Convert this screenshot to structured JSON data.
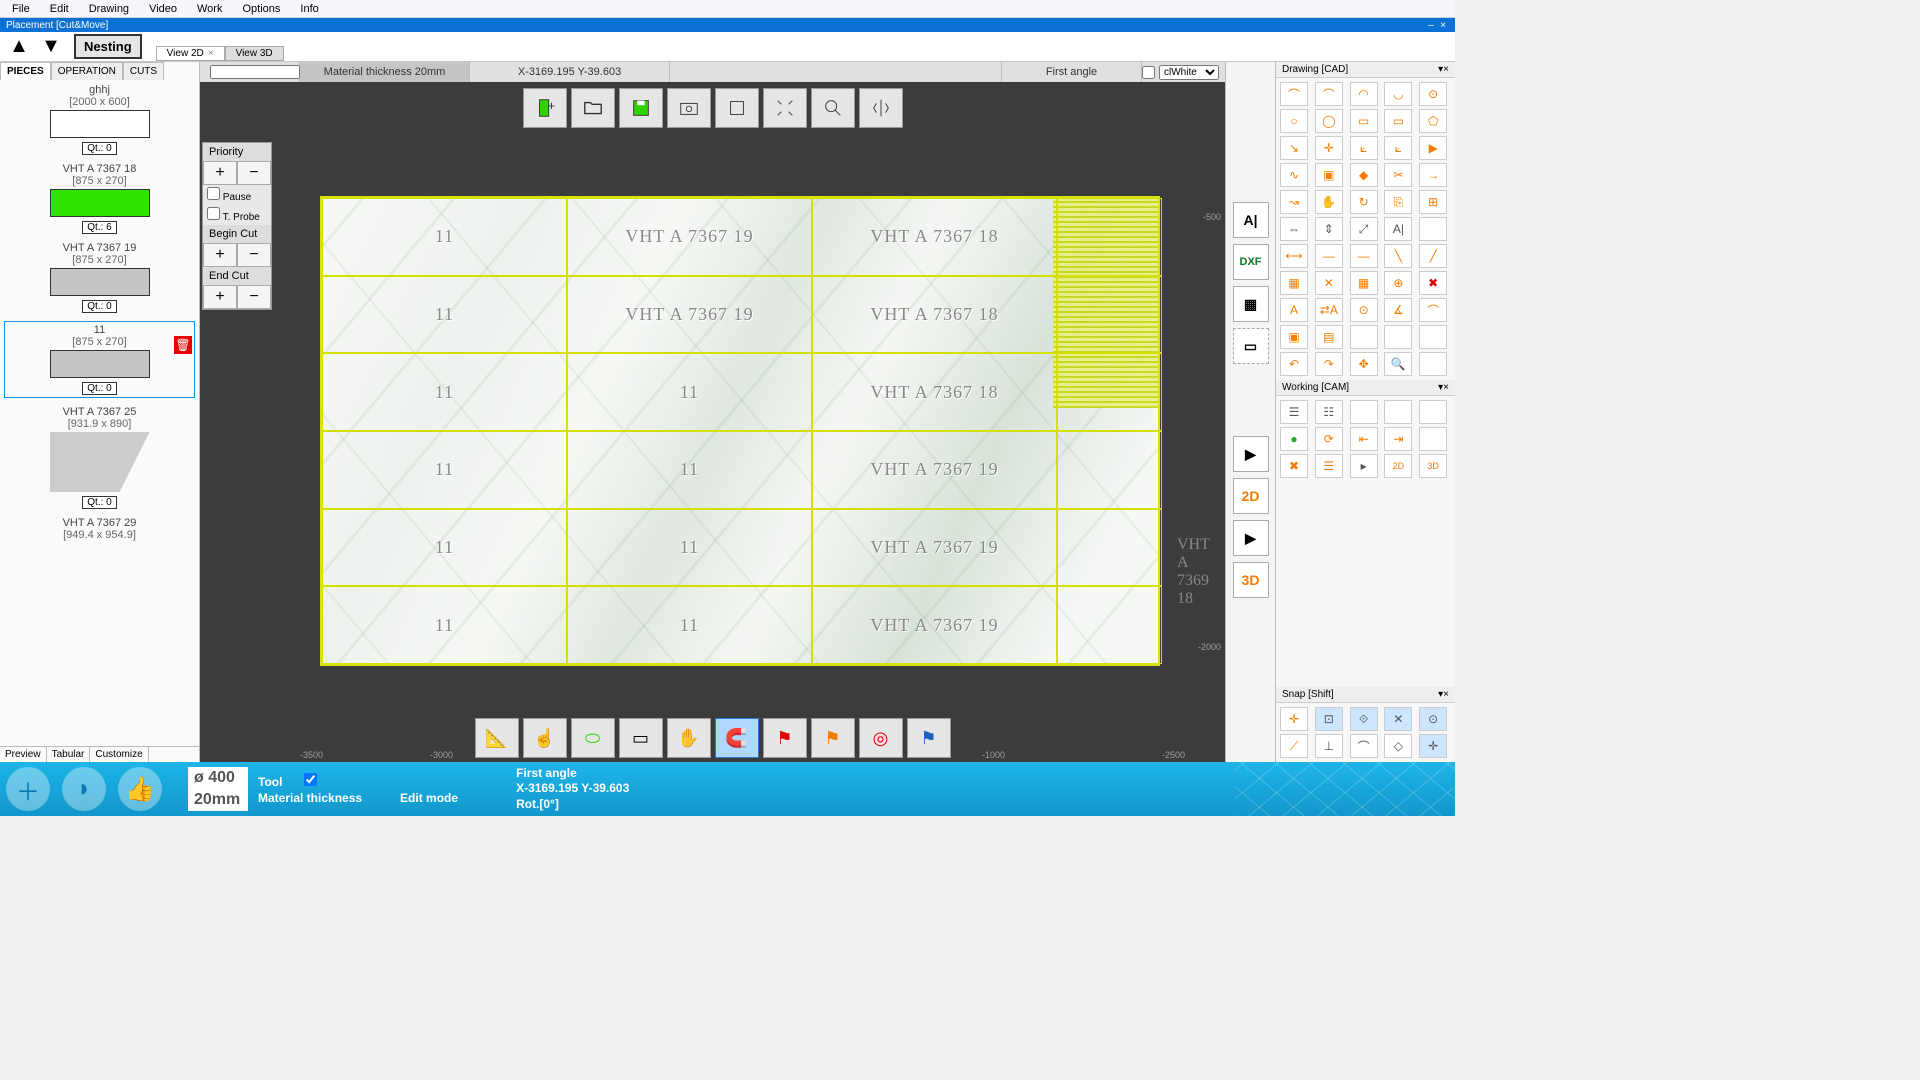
{
  "menu": [
    "File",
    "Edit",
    "Drawing",
    "Video",
    "Work",
    "Options",
    "Info"
  ],
  "title2": "Placement [Cut&Move]",
  "nesting": "Nesting",
  "view_tabs": [
    {
      "label": "View 2D",
      "active": true,
      "closable": true
    },
    {
      "label": "View 3D",
      "active": false,
      "closable": false
    }
  ],
  "left_tabs": [
    "PIECES",
    "OPERATION",
    "CUTS"
  ],
  "pieces": [
    {
      "name": "ghhj",
      "dims": "[2000 x 600]",
      "swatch": "white",
      "qt": "Qt.: 0"
    },
    {
      "name": "VHT A 7367  18",
      "dims": "[875 x 270]",
      "swatch": "green",
      "qt": "Qt.: 6"
    },
    {
      "name": "VHT A 7367  19",
      "dims": "[875 x 270]",
      "swatch": "grey",
      "qt": "Qt.: 0"
    },
    {
      "name": "11",
      "dims": "[875 x 270]",
      "swatch": "grey",
      "qt": "Qt.: 0",
      "selected": true,
      "trash": true
    },
    {
      "name": "VHT A 7367  25",
      "dims": "[931.9 x 890]",
      "swatch": "poly",
      "qt": "Qt.: 0"
    },
    {
      "name": "VHT A 7367  29",
      "dims": "[949.4 x 954.9]",
      "swatch": "poly",
      "qt": ""
    }
  ],
  "bottom_tabs": [
    "Preview",
    "Tabular",
    "Customize"
  ],
  "infobar": {
    "thickness": "Material thickness 20mm",
    "coords": "X-3169.195 Y-39.603",
    "angle": "First angle",
    "color_opt": "clWhite"
  },
  "prio": {
    "priority": "Priority",
    "pause": "Pause",
    "probe": "T. Probe",
    "begin": "Begin Cut",
    "end": "End Cut"
  },
  "grid_labels": [
    [
      "11",
      "VHT A 7367  19",
      "VHT A 7367  18",
      ""
    ],
    [
      "11",
      "VHT A 7367  19",
      "VHT A 7367  18",
      ""
    ],
    [
      "11",
      "11",
      "VHT A 7367  18",
      ""
    ],
    [
      "11",
      "11",
      "VHT A 7367  19",
      ""
    ],
    [
      "11",
      "11",
      "VHT A 7367  19",
      ""
    ],
    [
      "11",
      "11",
      "VHT A 7367  19",
      ""
    ]
  ],
  "extra_label": "VHT A 7369   18",
  "sidebar_btns": [
    "A|",
    "DXF",
    "▦",
    "▭",
    "▶",
    "2D",
    "▶",
    "3D"
  ],
  "right_panels": {
    "drawing": "Drawing [CAD]",
    "working": "Working [CAM]",
    "snap": "Snap [Shift]"
  },
  "status": {
    "diam": "ø 400",
    "thick": "20mm",
    "tool": "Tool",
    "matthick": "Material thickness",
    "editmode": "Edit mode",
    "line1": "First angle",
    "line2": "X-3169.195 Y-39.603",
    "line3": "Rot.[0°]"
  },
  "ruler": {
    "l1": "-3500",
    "l2": "-3000",
    "l3": "-1000",
    "l4": "-2500",
    "r1": "-500",
    "r2": "-2000"
  }
}
